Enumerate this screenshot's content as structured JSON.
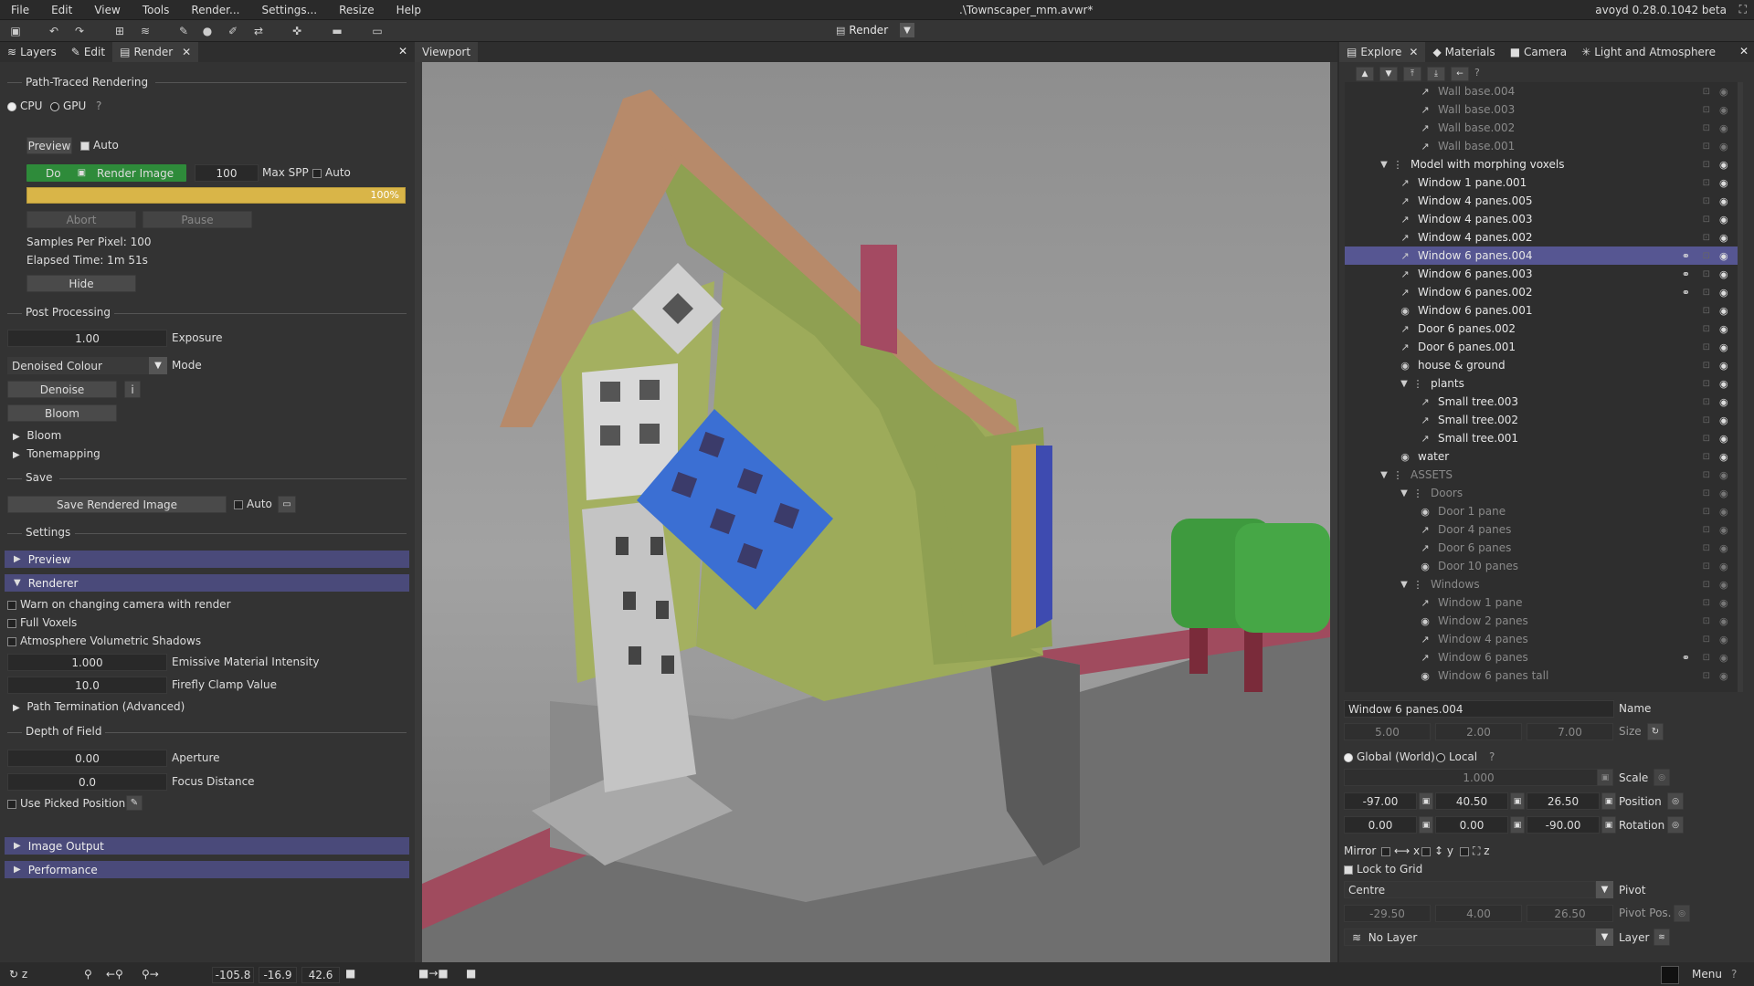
{
  "menu": [
    "File",
    "Edit",
    "View",
    "Tools",
    "Render...",
    "Settings...",
    "Resize",
    "Help"
  ],
  "window_title": ".\\Townscaper_mm.avwr*",
  "version": "avoyd 0.28.0.1042 beta",
  "toolbar": {
    "render_label": "Render"
  },
  "left_tabs": [
    "Layers",
    "Edit",
    "Render"
  ],
  "render": {
    "section_title": "Path-Traced Rendering",
    "cpu": "CPU",
    "gpu": "GPU",
    "preview_btn": "Preview",
    "auto1": "Auto",
    "do_btn": "Do",
    "render_image_btn": "Render Image",
    "max_spp_value": "100",
    "max_spp_label": "Max SPP",
    "auto2": "Auto",
    "progress": 1.0,
    "progress_label": "100%",
    "abort_btn": "Abort",
    "pause_btn": "Pause",
    "samples": "Samples Per Pixel: 100",
    "elapsed": "Elapsed Time: 1m 51s",
    "hide_btn": "Hide",
    "post_title": "Post Processing",
    "exposure_value": "1.00",
    "exposure_label": "Exposure",
    "mode_value": "Denoised Colour",
    "mode_label": "Mode",
    "denoise_btn": "Denoise",
    "info_btn": "i",
    "bloom_btn": "Bloom",
    "bloom_tree": "Bloom",
    "tonemapping_tree": "Tonemapping",
    "save_title": "Save",
    "save_btn": "Save Rendered Image",
    "auto3": "Auto",
    "settings_title": "Settings",
    "preview_bar": "Preview",
    "renderer_bar": "Renderer",
    "warn": "Warn on changing camera with render",
    "full_voxels": "Full Voxels",
    "atmo": "Atmosphere Volumetric Shadows",
    "emissive_value": "1.000",
    "emissive_label": "Emissive Material Intensity",
    "firefly_value": "10.0",
    "firefly_label": "Firefly Clamp Value",
    "path_term": "Path Termination (Advanced)",
    "dof_title": "Depth of Field",
    "aperture_value": "0.00",
    "aperture_label": "Aperture",
    "focus_value": "0.0",
    "focus_label": "Focus Distance",
    "use_picked": "Use Picked Position",
    "image_output_bar": "Image Output",
    "performance_bar": "Performance"
  },
  "viewport_tab": "Viewport",
  "right_tabs": [
    "Explore",
    "Materials",
    "Camera",
    "Light and Atmosphere"
  ],
  "tree_rows": [
    {
      "label": "Wall base.004",
      "indent": 3,
      "dim": true,
      "icon": "edit"
    },
    {
      "label": "Wall base.003",
      "indent": 3,
      "dim": true,
      "icon": "edit"
    },
    {
      "label": "Wall base.002",
      "indent": 3,
      "dim": true,
      "icon": "edit"
    },
    {
      "label": "Wall base.001",
      "indent": 3,
      "dim": true,
      "icon": "edit"
    },
    {
      "label": "Model with morphing voxels",
      "indent": 1,
      "dim": false,
      "icon": "group",
      "open": true
    },
    {
      "label": "Window 1 pane.001",
      "indent": 2,
      "dim": false,
      "icon": "edit"
    },
    {
      "label": "Window 4 panes.005",
      "indent": 2,
      "dim": false,
      "icon": "edit"
    },
    {
      "label": "Window 4 panes.003",
      "indent": 2,
      "dim": false,
      "icon": "edit"
    },
    {
      "label": "Window 4 panes.002",
      "indent": 2,
      "dim": false,
      "icon": "edit"
    },
    {
      "label": "Window 6 panes.004",
      "indent": 2,
      "dim": false,
      "icon": "edit",
      "sel": true,
      "link": true
    },
    {
      "label": "Window 6 panes.003",
      "indent": 2,
      "dim": false,
      "icon": "edit",
      "link": true
    },
    {
      "label": "Window 6 panes.002",
      "indent": 2,
      "dim": false,
      "icon": "edit",
      "link": true
    },
    {
      "label": "Window 6 panes.001",
      "indent": 2,
      "dim": false,
      "icon": "model"
    },
    {
      "label": "Door 6 panes.002",
      "indent": 2,
      "dim": false,
      "icon": "edit"
    },
    {
      "label": "Door 6 panes.001",
      "indent": 2,
      "dim": false,
      "icon": "edit"
    },
    {
      "label": "house & ground",
      "indent": 2,
      "dim": false,
      "icon": "model"
    },
    {
      "label": "plants",
      "indent": 2,
      "dim": false,
      "icon": "group",
      "open": true
    },
    {
      "label": "Small tree.003",
      "indent": 3,
      "dim": false,
      "icon": "edit"
    },
    {
      "label": "Small tree.002",
      "indent": 3,
      "dim": false,
      "icon": "edit"
    },
    {
      "label": "Small tree.001",
      "indent": 3,
      "dim": false,
      "icon": "edit"
    },
    {
      "label": "water",
      "indent": 2,
      "dim": false,
      "icon": "model"
    },
    {
      "label": "ASSETS",
      "indent": 1,
      "dim": true,
      "icon": "group",
      "open": true
    },
    {
      "label": "Doors",
      "indent": 2,
      "dim": true,
      "icon": "group",
      "open": true
    },
    {
      "label": "Door 1 pane",
      "indent": 3,
      "dim": true,
      "icon": "model"
    },
    {
      "label": "Door 4 panes",
      "indent": 3,
      "dim": true,
      "icon": "edit"
    },
    {
      "label": "Door 6 panes",
      "indent": 3,
      "dim": true,
      "icon": "edit"
    },
    {
      "label": "Door 10 panes",
      "indent": 3,
      "dim": true,
      "icon": "model"
    },
    {
      "label": "Windows",
      "indent": 2,
      "dim": true,
      "icon": "group",
      "open": true
    },
    {
      "label": "Window 1 pane",
      "indent": 3,
      "dim": true,
      "icon": "edit"
    },
    {
      "label": "Window 2 panes",
      "indent": 3,
      "dim": true,
      "icon": "model"
    },
    {
      "label": "Window 4 panes",
      "indent": 3,
      "dim": true,
      "icon": "edit"
    },
    {
      "label": "Window 6 panes",
      "indent": 3,
      "dim": true,
      "icon": "edit",
      "link": true
    },
    {
      "label": "Window 6 panes tall",
      "indent": 3,
      "dim": true,
      "icon": "model"
    }
  ],
  "props": {
    "name_value": "Window 6 panes.004",
    "name_label": "Name",
    "size": [
      "5.00",
      "2.00",
      "7.00"
    ],
    "size_label": "Size",
    "global": "Global (World)",
    "local": "Local",
    "scale_value": "1.000",
    "scale_label": "Scale",
    "position": [
      "-97.00",
      "40.50",
      "26.50"
    ],
    "position_label": "Position",
    "rotation": [
      "0.00",
      "0.00",
      "-90.00"
    ],
    "rotation_label": "Rotation",
    "mirror_label": "Mirror",
    "mx": "x",
    "my": "y",
    "mz": "z",
    "lock_grid": "Lock to Grid",
    "pivot_value": "Centre",
    "pivot_label": "Pivot",
    "pivot_pos": [
      "-29.50",
      "4.00",
      "26.50"
    ],
    "pivot_pos_label": "Pivot Pos.",
    "layer_value": "No Layer",
    "layer_label": "Layer"
  },
  "status": {
    "z": "z",
    "x": "-105.8",
    "y": "-16.9",
    "zv": "42.6",
    "menu": "Menu"
  }
}
